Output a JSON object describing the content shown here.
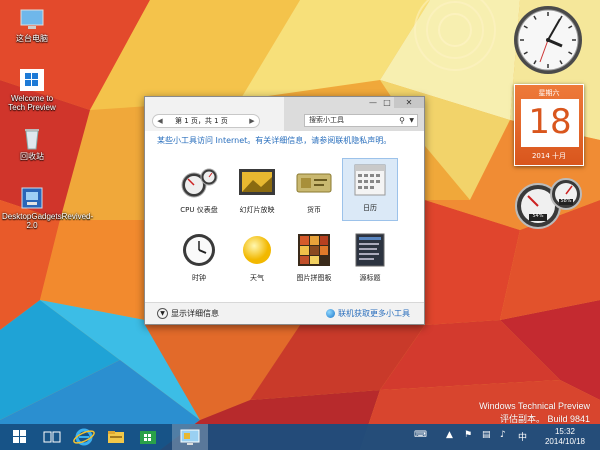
{
  "desktop": {
    "icons": [
      {
        "label": "这台电脑",
        "icon": "computer-icon"
      },
      {
        "label": "Welcome to Tech Preview",
        "icon": "windows-icon"
      },
      {
        "label": "回收站",
        "icon": "recycle-bin-icon"
      },
      {
        "label": "DesktopGadgetsRevived-2.0",
        "icon": "installer-icon"
      }
    ]
  },
  "gadget_window": {
    "pager": {
      "text": "第 1 页，共 1 页",
      "prev": "◀",
      "next": "▶"
    },
    "search": {
      "placeholder": "搜索小工具",
      "icon": "search-icon"
    },
    "info": "某些小工具访问 Internet。有关详细信息，请参阅联机隐私声明。",
    "gadgets": [
      {
        "label": "CPU 仪表盘",
        "icon": "cpu-meter-icon"
      },
      {
        "label": "幻灯片放映",
        "icon": "slideshow-icon"
      },
      {
        "label": "货币",
        "icon": "currency-icon"
      },
      {
        "label": "日历",
        "icon": "calendar-icon",
        "selected": true
      },
      {
        "label": "时钟",
        "icon": "clock-icon"
      },
      {
        "label": "天气",
        "icon": "weather-icon"
      },
      {
        "label": "图片拼图板",
        "icon": "puzzle-icon"
      },
      {
        "label": "源标题",
        "icon": "feed-icon"
      }
    ],
    "footer": {
      "details": "显示详细信息",
      "details_icon": "chevron-down-icon",
      "online": "联机获取更多小工具",
      "online_icon": "globe-icon"
    },
    "title_buttons": {
      "minimize": "—",
      "maximize": "□",
      "close": "✕"
    }
  },
  "calendar_gadget": {
    "weekday": "星期六",
    "day": "18",
    "month": "2014 十月"
  },
  "cpu_gadget": {
    "cpu": "54%",
    "memory": "58%"
  },
  "watermark": {
    "line1": "Windows Technical Preview",
    "line2": "评估副本。 Build 9841"
  },
  "taskbar": {
    "items": [
      {
        "icon": "start-icon"
      },
      {
        "icon": "task-view-icon"
      },
      {
        "icon": "internet-explorer-icon"
      },
      {
        "icon": "file-explorer-icon"
      },
      {
        "icon": "store-icon"
      },
      {
        "icon": "gadgets-icon",
        "active": true
      }
    ],
    "time": "15:32",
    "date": "2014/10/18"
  },
  "colors": {
    "accent": "#2a6fbd",
    "calendar": "#d9561d",
    "taskbar": "#164e80"
  }
}
